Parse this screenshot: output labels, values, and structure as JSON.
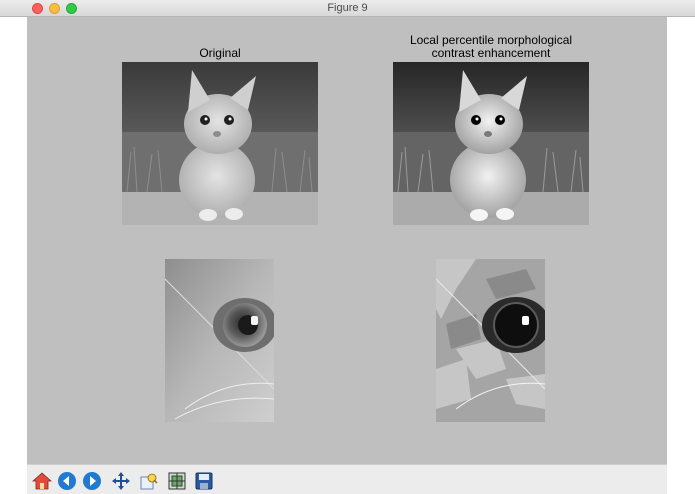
{
  "window": {
    "title": "Figure 9"
  },
  "panels": {
    "top_left_title": "Original",
    "top_right_title_line1": "Local percentile morphological",
    "top_right_title_line2": "contrast enhancement"
  },
  "toolbar": {
    "buttons": [
      {
        "name": "home",
        "icon": "home-icon"
      },
      {
        "name": "back",
        "icon": "back-arrow-icon"
      },
      {
        "name": "forward",
        "icon": "forward-arrow-icon"
      },
      {
        "name": "pan",
        "icon": "move-icon"
      },
      {
        "name": "zoom",
        "icon": "zoom-icon"
      },
      {
        "name": "configure-subplots",
        "icon": "subplots-icon"
      },
      {
        "name": "save",
        "icon": "save-icon"
      }
    ]
  },
  "colors": {
    "figure_bg": "#bfbfbf",
    "toolbar_bg": "#ececec"
  }
}
